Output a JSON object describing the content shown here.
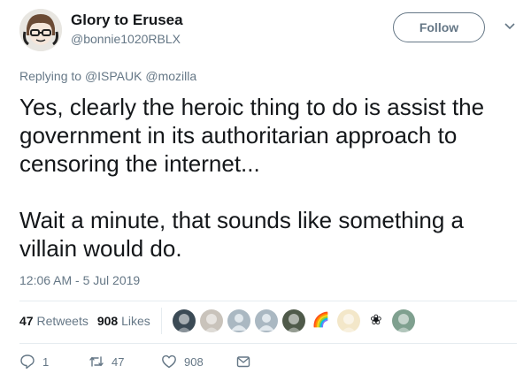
{
  "header": {
    "display_name": "Glory to Erusea",
    "handle": "@bonnie1020RBLX",
    "follow_label": "Follow"
  },
  "reply": {
    "prefix": "Replying to",
    "mentions": [
      "@ISPAUK",
      "@mozilla"
    ]
  },
  "tweet": {
    "paragraphs": [
      "Yes, clearly the heroic thing to do is assist the government in its authoritarian approach to censoring the internet...",
      "Wait a minute, that sounds like something a villain would do."
    ],
    "timestamp": "12:06 AM - 5 Jul 2019"
  },
  "stats": {
    "retweets_count": "47",
    "retweets_label": "Retweets",
    "likes_count": "908",
    "likes_label": "Likes"
  },
  "likers": [
    {
      "icon": "avatar-dark-icon",
      "bg": "#3b4a55",
      "glyph": ""
    },
    {
      "icon": "avatar-cat-icon",
      "bg": "#c9c3bb",
      "glyph": ""
    },
    {
      "icon": "avatar-default-icon",
      "bg": "#aab8c2",
      "glyph": ""
    },
    {
      "icon": "avatar-default-icon",
      "bg": "#aab8c2",
      "glyph": ""
    },
    {
      "icon": "avatar-character-icon",
      "bg": "#4f5a4a",
      "glyph": ""
    },
    {
      "icon": "avatar-rainbow-icon",
      "bg": "#ffffff",
      "glyph": "🌈"
    },
    {
      "icon": "avatar-anime-icon",
      "bg": "#f3e7c9",
      "glyph": ""
    },
    {
      "icon": "avatar-flower-icon",
      "bg": "#ffffff",
      "glyph": "❀"
    },
    {
      "icon": "avatar-figure-icon",
      "bg": "#7fa08f",
      "glyph": ""
    }
  ],
  "actions": {
    "reply_count": "1",
    "retweet_count": "47",
    "like_count": "908"
  },
  "colors": {
    "text_primary": "#14171a",
    "text_secondary": "#657786",
    "divider": "#e6ecf0"
  }
}
